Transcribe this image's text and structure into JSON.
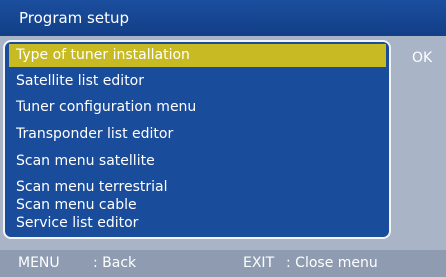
{
  "title": "Program setup",
  "ok_label": "OK",
  "menu": {
    "items": [
      {
        "label": "Type of tuner installation",
        "selected": true
      },
      {
        "label": "Satellite list editor"
      },
      {
        "label": "Tuner configuration menu"
      },
      {
        "label": "Transponder list editor"
      },
      {
        "label": "Scan menu satellite"
      },
      {
        "label": "Scan menu terrestrial"
      },
      {
        "label": "Scan menu cable"
      },
      {
        "label": "Service list editor"
      }
    ]
  },
  "footer": {
    "menu_key": "MENU",
    "menu_action": ": Back",
    "exit_key": "EXIT",
    "exit_action": ": Close menu"
  },
  "colors": {
    "title_bar": "#1b4e9e",
    "menu_background": "#1a4c9c",
    "selection_highlight": "#c8ba22",
    "panel_background": "#a9b4c7"
  }
}
